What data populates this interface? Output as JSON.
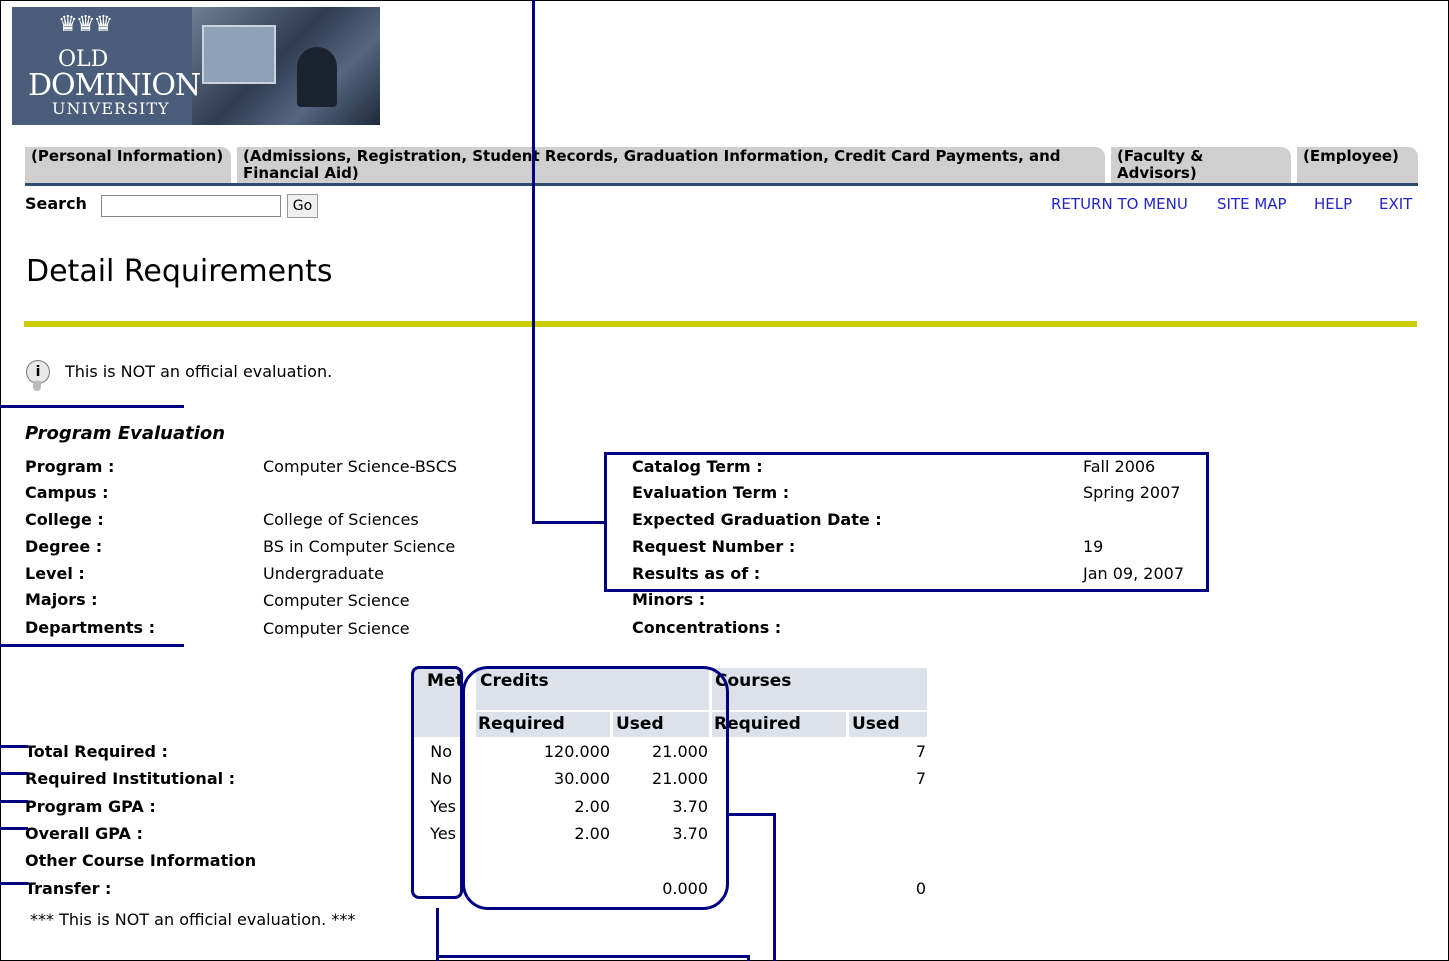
{
  "header": {
    "logo": {
      "old": "OLD",
      "dominion": "DOMINION",
      "university": "UNIVERSITY"
    },
    "tabs": [
      {
        "label": "(Personal Information)"
      },
      {
        "label": "(Admissions, Registration, Student Records, Graduation Information, Credit Card Payments, and Financial Aid)"
      },
      {
        "label": "(Faculty & Advisors)"
      },
      {
        "label": "(Employee)"
      }
    ],
    "search_label": "Search",
    "search_value": "",
    "go_label": "Go",
    "links": [
      {
        "label": "RETURN TO MENU"
      },
      {
        "label": "SITE MAP"
      },
      {
        "label": "HELP"
      },
      {
        "label": "EXIT"
      }
    ]
  },
  "page_title": "Detail Requirements",
  "notice": "This is NOT an official evaluation.",
  "program_evaluation": {
    "heading": "Program Evaluation",
    "left": [
      {
        "label": "Program :",
        "value": "Computer Science-BSCS"
      },
      {
        "label": "Campus :",
        "value": ""
      },
      {
        "label": "College :",
        "value": "College of Sciences"
      },
      {
        "label": "Degree :",
        "value": "BS in Computer Science"
      },
      {
        "label": "Level :",
        "value": "Undergraduate"
      },
      {
        "label": "Majors :",
        "value": "Computer Science"
      },
      {
        "label": "Departments :",
        "value": "Computer Science"
      }
    ],
    "right": [
      {
        "label": "Catalog Term :",
        "value": "Fall 2006"
      },
      {
        "label": "Evaluation Term :",
        "value": "Spring 2007"
      },
      {
        "label": "Expected Graduation Date :",
        "value": ""
      },
      {
        "label": "Request Number :",
        "value": "19"
      },
      {
        "label": "Results as of :",
        "value": "Jan 09, 2007"
      },
      {
        "label": "Minors :",
        "value": ""
      },
      {
        "label": "Concentrations :",
        "value": ""
      }
    ]
  },
  "requirements_table": {
    "headers": {
      "met": "Met",
      "credits": "Credits",
      "courses": "Courses",
      "credits_required": "Required",
      "credits_used": "Used",
      "courses_required": "Required",
      "courses_used": "Used"
    },
    "rows": [
      {
        "label": "Total Required :",
        "met": "No",
        "credits_required": "120.000",
        "credits_used": "21.000",
        "courses_required": "",
        "courses_used": "7"
      },
      {
        "label": "Required Institutional :",
        "met": "No",
        "credits_required": "30.000",
        "credits_used": "21.000",
        "courses_required": "",
        "courses_used": "7"
      },
      {
        "label": "Program GPA :",
        "met": "Yes",
        "credits_required": "2.00",
        "credits_used": "3.70",
        "courses_required": "",
        "courses_used": ""
      },
      {
        "label": "Overall GPA :",
        "met": "Yes",
        "credits_required": "2.00",
        "credits_used": "3.70",
        "courses_required": "",
        "courses_used": ""
      },
      {
        "label": "Other Course Information",
        "met": "",
        "credits_required": "",
        "credits_used": "",
        "courses_required": "",
        "courses_used": ""
      },
      {
        "label": "Transfer :",
        "met": "",
        "credits_required": "",
        "credits_used": "0.000",
        "courses_required": "",
        "courses_used": "0"
      }
    ]
  },
  "footnote": "*** This is NOT an official evaluation. ***",
  "colors": {
    "annotation": "#000080",
    "tab": "#cfcfcf",
    "tab_line": "#2f4d6d",
    "gold_bar": "#cccc00",
    "link": "#2424cc",
    "table_header": "#dde1ea"
  }
}
